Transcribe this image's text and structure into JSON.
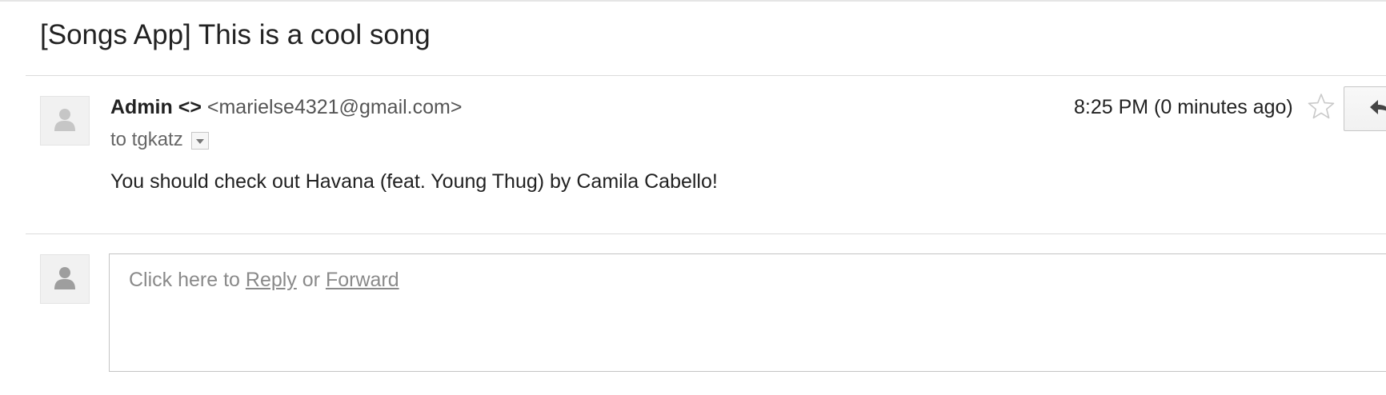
{
  "email": {
    "subject": "[Songs App] This is a cool song",
    "sender_name": "Admin <>",
    "sender_email": "<marielse4321@gmail.com>",
    "to_line": "to tgkatz",
    "timestamp": "8:25 PM (0 minutes ago)",
    "body": "You should check out Havana (feat. Young Thug) by Camila Cabello!"
  },
  "reply": {
    "prefix": "Click here to ",
    "reply_link": "Reply",
    "middle": " or ",
    "forward_link": "Forward"
  },
  "icons": {
    "avatar": "person-silhouette-icon",
    "details_toggle": "chevron-down-icon",
    "star": "star-outline-icon",
    "reply": "reply-arrow-icon"
  },
  "colors": {
    "avatar_bg": "#f1f1f1",
    "avatar_glyph": "#c6c6c6",
    "muted_text": "#8a8a8a",
    "divider": "#dcdcdc"
  }
}
